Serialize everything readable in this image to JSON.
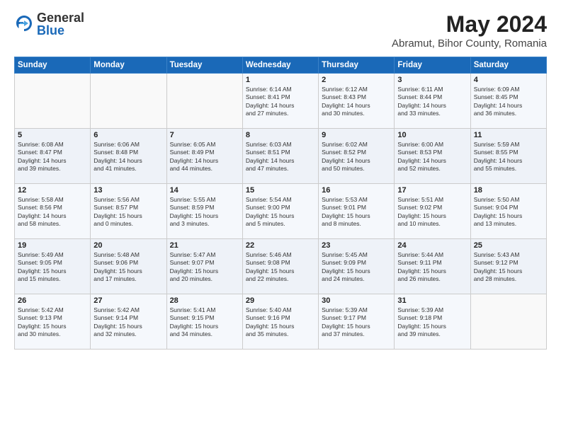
{
  "header": {
    "logo_general": "General",
    "logo_blue": "Blue",
    "title": "May 2024",
    "subtitle": "Abramut, Bihor County, Romania"
  },
  "days_of_week": [
    "Sunday",
    "Monday",
    "Tuesday",
    "Wednesday",
    "Thursday",
    "Friday",
    "Saturday"
  ],
  "weeks": [
    [
      {
        "day": "",
        "info": ""
      },
      {
        "day": "",
        "info": ""
      },
      {
        "day": "",
        "info": ""
      },
      {
        "day": "1",
        "info": "Sunrise: 6:14 AM\nSunset: 8:41 PM\nDaylight: 14 hours\nand 27 minutes."
      },
      {
        "day": "2",
        "info": "Sunrise: 6:12 AM\nSunset: 8:43 PM\nDaylight: 14 hours\nand 30 minutes."
      },
      {
        "day": "3",
        "info": "Sunrise: 6:11 AM\nSunset: 8:44 PM\nDaylight: 14 hours\nand 33 minutes."
      },
      {
        "day": "4",
        "info": "Sunrise: 6:09 AM\nSunset: 8:45 PM\nDaylight: 14 hours\nand 36 minutes."
      }
    ],
    [
      {
        "day": "5",
        "info": "Sunrise: 6:08 AM\nSunset: 8:47 PM\nDaylight: 14 hours\nand 39 minutes."
      },
      {
        "day": "6",
        "info": "Sunrise: 6:06 AM\nSunset: 8:48 PM\nDaylight: 14 hours\nand 41 minutes."
      },
      {
        "day": "7",
        "info": "Sunrise: 6:05 AM\nSunset: 8:49 PM\nDaylight: 14 hours\nand 44 minutes."
      },
      {
        "day": "8",
        "info": "Sunrise: 6:03 AM\nSunset: 8:51 PM\nDaylight: 14 hours\nand 47 minutes."
      },
      {
        "day": "9",
        "info": "Sunrise: 6:02 AM\nSunset: 8:52 PM\nDaylight: 14 hours\nand 50 minutes."
      },
      {
        "day": "10",
        "info": "Sunrise: 6:00 AM\nSunset: 8:53 PM\nDaylight: 14 hours\nand 52 minutes."
      },
      {
        "day": "11",
        "info": "Sunrise: 5:59 AM\nSunset: 8:55 PM\nDaylight: 14 hours\nand 55 minutes."
      }
    ],
    [
      {
        "day": "12",
        "info": "Sunrise: 5:58 AM\nSunset: 8:56 PM\nDaylight: 14 hours\nand 58 minutes."
      },
      {
        "day": "13",
        "info": "Sunrise: 5:56 AM\nSunset: 8:57 PM\nDaylight: 15 hours\nand 0 minutes."
      },
      {
        "day": "14",
        "info": "Sunrise: 5:55 AM\nSunset: 8:59 PM\nDaylight: 15 hours\nand 3 minutes."
      },
      {
        "day": "15",
        "info": "Sunrise: 5:54 AM\nSunset: 9:00 PM\nDaylight: 15 hours\nand 5 minutes."
      },
      {
        "day": "16",
        "info": "Sunrise: 5:53 AM\nSunset: 9:01 PM\nDaylight: 15 hours\nand 8 minutes."
      },
      {
        "day": "17",
        "info": "Sunrise: 5:51 AM\nSunset: 9:02 PM\nDaylight: 15 hours\nand 10 minutes."
      },
      {
        "day": "18",
        "info": "Sunrise: 5:50 AM\nSunset: 9:04 PM\nDaylight: 15 hours\nand 13 minutes."
      }
    ],
    [
      {
        "day": "19",
        "info": "Sunrise: 5:49 AM\nSunset: 9:05 PM\nDaylight: 15 hours\nand 15 minutes."
      },
      {
        "day": "20",
        "info": "Sunrise: 5:48 AM\nSunset: 9:06 PM\nDaylight: 15 hours\nand 17 minutes."
      },
      {
        "day": "21",
        "info": "Sunrise: 5:47 AM\nSunset: 9:07 PM\nDaylight: 15 hours\nand 20 minutes."
      },
      {
        "day": "22",
        "info": "Sunrise: 5:46 AM\nSunset: 9:08 PM\nDaylight: 15 hours\nand 22 minutes."
      },
      {
        "day": "23",
        "info": "Sunrise: 5:45 AM\nSunset: 9:09 PM\nDaylight: 15 hours\nand 24 minutes."
      },
      {
        "day": "24",
        "info": "Sunrise: 5:44 AM\nSunset: 9:11 PM\nDaylight: 15 hours\nand 26 minutes."
      },
      {
        "day": "25",
        "info": "Sunrise: 5:43 AM\nSunset: 9:12 PM\nDaylight: 15 hours\nand 28 minutes."
      }
    ],
    [
      {
        "day": "26",
        "info": "Sunrise: 5:42 AM\nSunset: 9:13 PM\nDaylight: 15 hours\nand 30 minutes."
      },
      {
        "day": "27",
        "info": "Sunrise: 5:42 AM\nSunset: 9:14 PM\nDaylight: 15 hours\nand 32 minutes."
      },
      {
        "day": "28",
        "info": "Sunrise: 5:41 AM\nSunset: 9:15 PM\nDaylight: 15 hours\nand 34 minutes."
      },
      {
        "day": "29",
        "info": "Sunrise: 5:40 AM\nSunset: 9:16 PM\nDaylight: 15 hours\nand 35 minutes."
      },
      {
        "day": "30",
        "info": "Sunrise: 5:39 AM\nSunset: 9:17 PM\nDaylight: 15 hours\nand 37 minutes."
      },
      {
        "day": "31",
        "info": "Sunrise: 5:39 AM\nSunset: 9:18 PM\nDaylight: 15 hours\nand 39 minutes."
      },
      {
        "day": "",
        "info": ""
      }
    ]
  ]
}
